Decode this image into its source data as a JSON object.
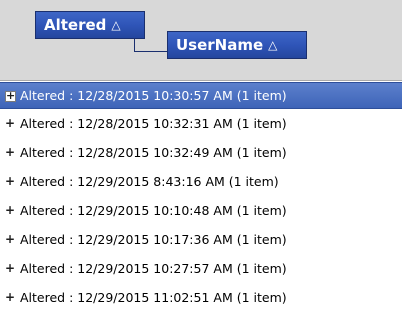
{
  "group_panel": {
    "chips": [
      {
        "label": "Altered",
        "sort_icon": "△"
      },
      {
        "label": "UserName",
        "sort_icon": "△"
      }
    ]
  },
  "groups": [
    {
      "text": "Altered : 12/28/2015 10:30:57 AM (1 item)",
      "selected": true
    },
    {
      "text": "Altered : 12/28/2015 10:32:31 AM (1 item)",
      "selected": false
    },
    {
      "text": "Altered : 12/28/2015 10:32:49 AM (1 item)",
      "selected": false
    },
    {
      "text": "Altered : 12/29/2015 8:43:16 AM (1 item)",
      "selected": false
    },
    {
      "text": "Altered : 12/29/2015 10:10:48 AM (1 item)",
      "selected": false
    },
    {
      "text": "Altered : 12/29/2015 10:17:36 AM (1 item)",
      "selected": false
    },
    {
      "text": "Altered : 12/29/2015 10:27:57 AM (1 item)",
      "selected": false
    },
    {
      "text": "Altered : 12/29/2015 11:02:51 AM (1 item)",
      "selected": false
    }
  ],
  "expand_glyph": "+",
  "colors": {
    "chip_background": "#2f55b8",
    "selection_background": "#4a6fc0",
    "panel_background": "#d8d8d8"
  }
}
